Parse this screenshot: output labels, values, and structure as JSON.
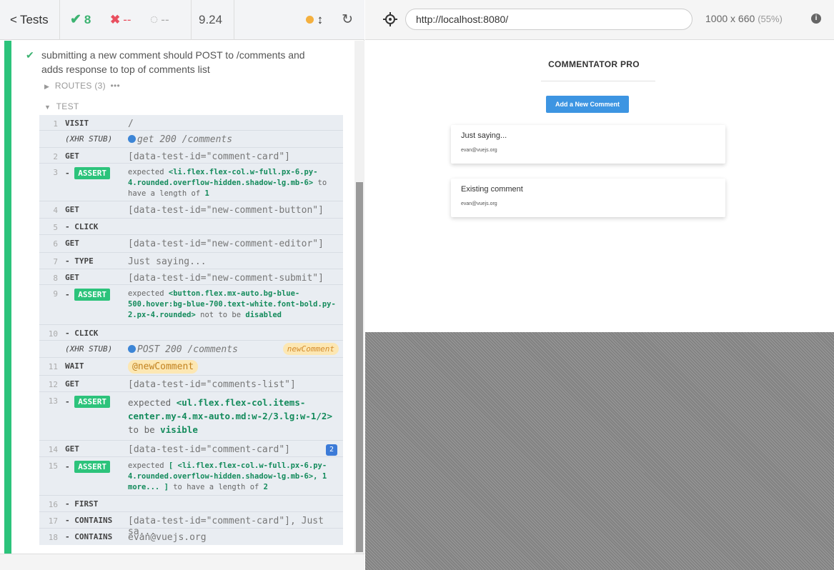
{
  "stats": {
    "tests_label": "Tests",
    "passed_count": "8",
    "failed_count": "--",
    "pending_count": "--",
    "duration": "9.24"
  },
  "test": {
    "title": "submitting a new comment should POST to /comments and adds response to top of comments list",
    "routes_label": "ROUTES (3)",
    "test_label": "TEST"
  },
  "commands": [
    {
      "num": "1",
      "name": "VISIT",
      "message": "/"
    },
    {
      "num": "",
      "name": "(XHR STUB)",
      "method": "get",
      "status": "200",
      "path": "/comments"
    },
    {
      "num": "2",
      "name": "GET",
      "message": "[data-test-id=\"comment-card\"]"
    },
    {
      "num": "3",
      "name": "- ASSERT",
      "expected": "expected",
      "subject": "<li.flex.flex-col.w-full.px-6.py-4.rounded.overflow-hidden.shadow-lg.mb-6>",
      "tail": "to have a length of",
      "value": "1"
    },
    {
      "num": "4",
      "name": "GET",
      "message": "[data-test-id=\"new-comment-button\"]"
    },
    {
      "num": "5",
      "name": "- CLICK",
      "message": ""
    },
    {
      "num": "6",
      "name": "GET",
      "message": "[data-test-id=\"new-comment-editor\"]"
    },
    {
      "num": "7",
      "name": "- TYPE",
      "message": "Just saying..."
    },
    {
      "num": "8",
      "name": "GET",
      "message": "[data-test-id=\"new-comment-submit\"]"
    },
    {
      "num": "9",
      "name": "- ASSERT",
      "expected": "expected",
      "subject": "<button.flex.mx-auto.bg-blue-500.hover:bg-blue-700.text-white.font-bold.py-2.px-4.rounded>",
      "tail": "not to be",
      "value": "disabled"
    },
    {
      "num": "10",
      "name": "- CLICK",
      "message": ""
    },
    {
      "num": "",
      "name": "(XHR STUB)",
      "method": "POST",
      "status": "200",
      "path": "/comments",
      "alias": "newComment"
    },
    {
      "num": "11",
      "name": "WAIT",
      "message": "@newComment"
    },
    {
      "num": "12",
      "name": "GET",
      "message": "[data-test-id=\"comments-list\"]"
    },
    {
      "num": "13",
      "name": "- ASSERT",
      "expected": "expected",
      "subject": "<ul.flex.flex-col.items-center.my-4.mx-auto.md:w-2/3.lg:w-1/2>",
      "tail": "to be",
      "value": "visible"
    },
    {
      "num": "14",
      "name": "GET",
      "message": "[data-test-id=\"comment-card\"]",
      "badge": "2"
    },
    {
      "num": "15",
      "name": "- ASSERT",
      "expected": "expected",
      "subject": "[ <li.flex.flex-col.w-full.px-6.py-4.rounded.overflow-hidden.shadow-lg.mb-6>, 1 more... ]",
      "tail": "to have a length of",
      "value": "2"
    },
    {
      "num": "16",
      "name": "- FIRST",
      "message": ""
    },
    {
      "num": "17",
      "name": "- CONTAINS",
      "message": "[data-test-id=\"comment-card\"], Just sa..."
    },
    {
      "num": "18",
      "name": "- CONTAINS",
      "message": "evan@vuejs.org"
    }
  ],
  "aut_header": {
    "url": "http://localhost:8080/",
    "viewport": "1000 x 660",
    "scale": "(55%)"
  },
  "app": {
    "title": "COMMENTATOR PRO",
    "add_button": "Add a New Comment",
    "comments": [
      {
        "text": "Just saying...",
        "email": "evan@vuejs.org"
      },
      {
        "text": "Existing comment",
        "email": "evan@vuejs.org"
      }
    ]
  },
  "colors": {
    "pass": "#2cc37b",
    "fail": "#e94f5f",
    "accent": "#3d95e2",
    "alias": "#fce7b3"
  }
}
